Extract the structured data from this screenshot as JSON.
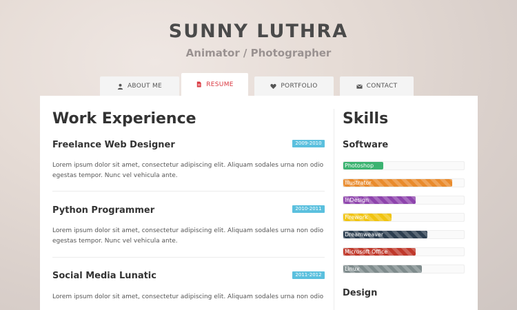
{
  "header": {
    "name": "SUNNY LUTHRA",
    "subtitle": "Animator / Photographer"
  },
  "tabs": [
    {
      "label": "ABOUT ME",
      "icon": "user-icon",
      "active": false
    },
    {
      "label": "RESUME",
      "icon": "document-icon",
      "active": true
    },
    {
      "label": "PORTFOLIO",
      "icon": "heart-icon",
      "active": false
    },
    {
      "label": "CONTACT",
      "icon": "envelope-icon",
      "active": false
    }
  ],
  "work": {
    "heading": "Work Experience",
    "jobs": [
      {
        "title": "Freelance Web Designer",
        "years": "2009-2010",
        "description_1": "Lorem ipsum dolor sit amet, consectetur adipiscing elit. Aliquam sodales urna non odio",
        "description_2": "egestas tempor. Nunc vel vehicula ante."
      },
      {
        "title": "Python Programmer",
        "years": "2010-2011",
        "description_1": "Lorem ipsum dolor sit amet, consectetur adipiscing elit. Aliquam sodales urna non odio",
        "description_2": "egestas tempor. Nunc vel vehicula ante."
      },
      {
        "title": "Social Media Lunatic",
        "years": "2011-2012",
        "description_1": "Lorem ipsum dolor sit amet, consectetur adipiscing elit. Aliquam sodales urna non odio",
        "description_2": ""
      }
    ],
    "badge_color": "#5bc0de"
  },
  "skills": {
    "heading": "Skills",
    "groups": [
      {
        "name": "Software",
        "items": [
          {
            "label": "Photoshop",
            "level": 0.33,
            "color": "#3cb371"
          },
          {
            "label": "Illustrator",
            "level": 0.9,
            "color": "#e98b2c"
          },
          {
            "label": "InDesign",
            "level": 0.6,
            "color": "#8e44ad"
          },
          {
            "label": "Firework",
            "level": 0.4,
            "color": "#f1c40f"
          },
          {
            "label": "Dreamweaver",
            "level": 0.7,
            "color": "#2c3e50"
          },
          {
            "label": "Microsoft Office",
            "level": 0.6,
            "color": "#c0392b"
          },
          {
            "label": "Linux",
            "level": 0.65,
            "color": "#7f8c8d"
          }
        ]
      },
      {
        "name": "Design",
        "items": []
      }
    ]
  }
}
